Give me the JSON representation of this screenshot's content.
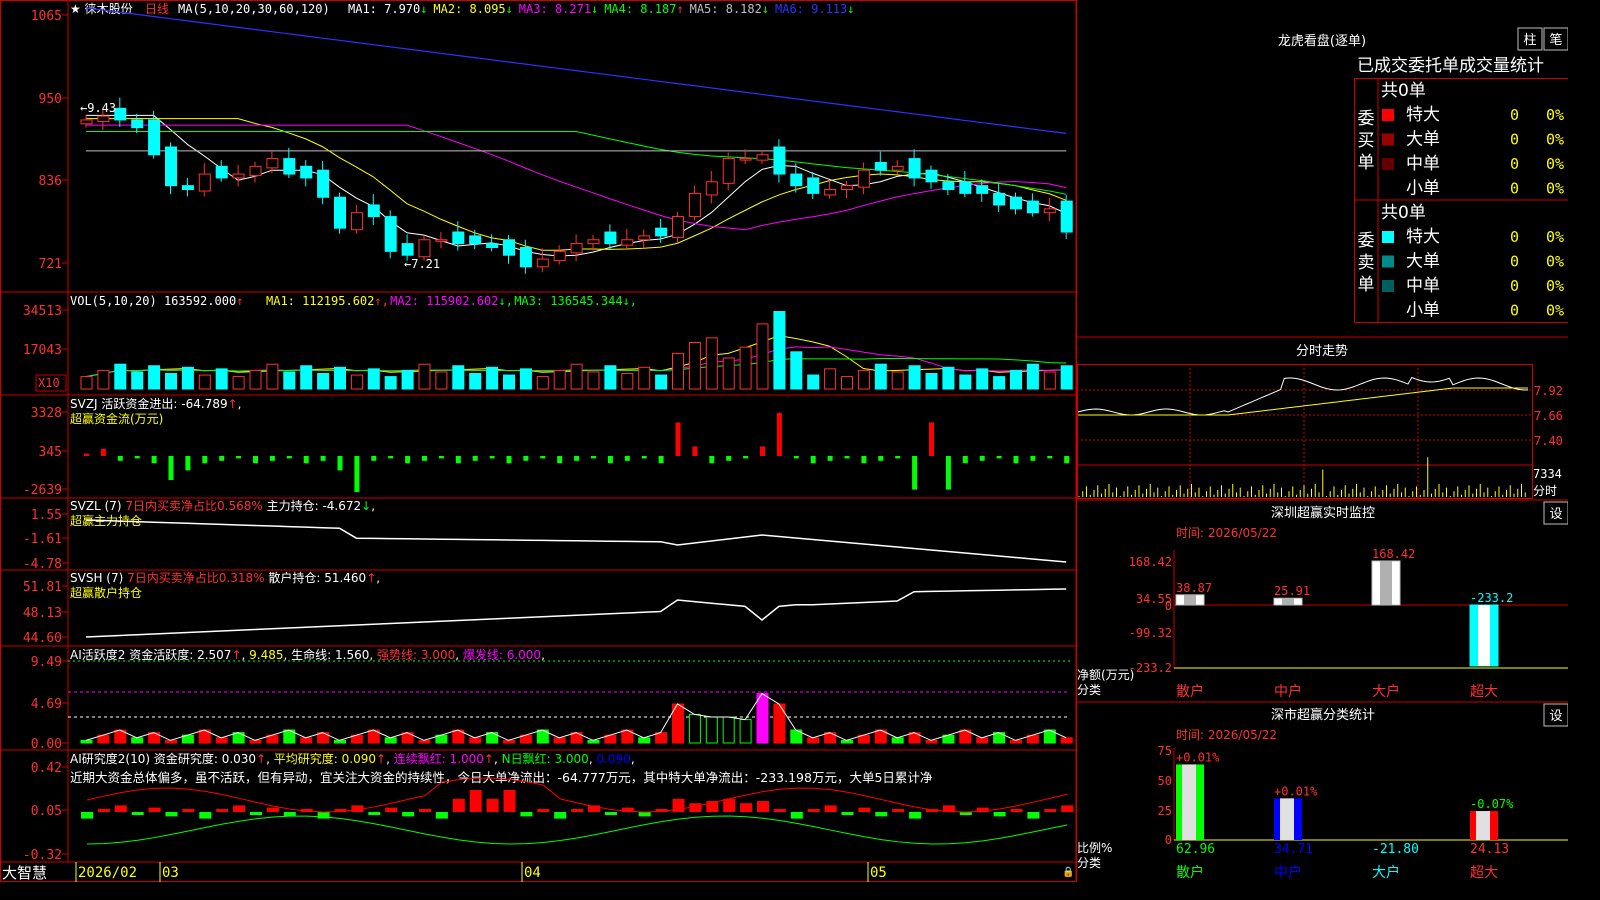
{
  "stock": {
    "name": "徕木股份",
    "period": "日线"
  },
  "main_panel": {
    "legend_ma_prefix": "MA(5,10,20,30,60,120)",
    "ma": [
      {
        "label": "MA1: 7.970",
        "arrow": "↓",
        "color": "#ffffff"
      },
      {
        "label": "MA2: 8.095",
        "arrow": "↓",
        "color": "#ffff00"
      },
      {
        "label": "MA3: 8.271",
        "arrow": "↓",
        "color": "#ff00ff"
      },
      {
        "label": "MA4: 8.187",
        "arrow": "↑",
        "color": "#00ff00"
      },
      {
        "label": "MA5: 8.182",
        "arrow": "↓",
        "color": "#c0c0c0"
      },
      {
        "label": "MA6: 9.113",
        "arrow": "↓",
        "color": "#3030ff"
      }
    ],
    "y_ticks": [
      "1065",
      "950",
      "836",
      "721"
    ],
    "high_label": "←9.43",
    "low_label": "←7.21",
    "y_range": [
      6.9,
      10.7
    ]
  },
  "vol_panel": {
    "title": "VOL(5,10,20)",
    "value": "163592.000",
    "value_arrow": "↑",
    "ma": [
      {
        "label": "MA1: 112195.602",
        "arrow": "↑",
        "color": "#ffff00"
      },
      {
        "label": "MA2: 115902.602",
        "arrow": "↓",
        "color": "#ff00ff"
      },
      {
        "label": "MA3: 136545.344",
        "arrow": "↓",
        "color": "#00ff00"
      }
    ],
    "y_ticks": [
      "34513",
      "17043"
    ],
    "unit": "X10"
  },
  "svzj_panel": {
    "title": "SVZJ",
    "label": "活跃资金进出: -64.789",
    "arrow": "↑",
    "subtitle": "超赢资金流(万元)",
    "y_ticks": [
      "3328",
      "345",
      "-2639"
    ]
  },
  "svzl_panel": {
    "title": "SVZL (7)",
    "label": "7日内买卖净占比0.568%",
    "label2": "主力持仓: -4.672",
    "arrow": "↓",
    "subtitle": "超赢主力持仓",
    "y_ticks": [
      "1.55",
      "-1.61",
      "-4.78"
    ]
  },
  "svsh_panel": {
    "title": "SVSH (7)",
    "label": "7日内买卖净占比0.318%",
    "label2": "散户持仓: 51.460",
    "arrow": "↑",
    "subtitle": "超赢散户持仓",
    "y_ticks": [
      "51.81",
      "48.13",
      "44.60"
    ]
  },
  "ai_active_panel": {
    "title": "AI活跃度2",
    "label": "资金活跃度: 2.507",
    "arrow": "↑",
    "value2": "9.485",
    "life_line": "生命线: 1.560",
    "strong_line": "强势线: 3.000",
    "burst_line": "爆发线: 6.000",
    "y_ticks": [
      "9.49",
      "4.69",
      "0.00"
    ]
  },
  "ai_research_panel": {
    "title": "AI研究度2(10)",
    "label": "资金研究度: 0.030",
    "avg": "平均研究度: 0.090",
    "cont": "连续飘红: 1.000",
    "nday": "N日飘红: 3.000",
    "nday2": "0.090",
    "comment": "近期大资金总体偏多，虽不活跃，但有异动，宜关注大资金的持续性，今日大单净流出：-64.777万元，其中特大单净流出：-233.198万元，大单5日累计净",
    "y_ticks": [
      "0.42",
      "0.05",
      "-0.32"
    ]
  },
  "footer": {
    "brand": "大智慧",
    "date_labels": [
      "2026/02",
      "03",
      "04",
      "05"
    ]
  },
  "right": {
    "longhu": {
      "title": "龙虎看盘(逐单)",
      "btn1": "柱",
      "btn2": "笔",
      "tabs": "已成交委托单成交量统计",
      "buy": {
        "side": "委买单",
        "total": "共0单",
        "rows": [
          {
            "label": "特大",
            "val": "0",
            "pct": "0%",
            "color": "#ff0000"
          },
          {
            "label": "大单",
            "val": "0",
            "pct": "0%",
            "color": "#990000"
          },
          {
            "label": "中单",
            "val": "0",
            "pct": "0%",
            "color": "#660000"
          },
          {
            "label": "小单",
            "val": "0",
            "pct": "0%",
            "color": "#000000"
          }
        ]
      },
      "sell": {
        "side": "委卖单",
        "total": "共0单",
        "rows": [
          {
            "label": "特大",
            "val": "0",
            "pct": "0%",
            "color": "#00ffff"
          },
          {
            "label": "大单",
            "val": "0",
            "pct": "0%",
            "color": "#008b8b"
          },
          {
            "label": "中单",
            "val": "0",
            "pct": "0%",
            "color": "#006060"
          },
          {
            "label": "小单",
            "val": "0",
            "pct": "0%",
            "color": "#000000"
          }
        ]
      }
    },
    "intraday": {
      "title": "分时走势",
      "y_ticks": [
        "7.92",
        "7.66",
        "7.40"
      ],
      "vol_tick": "7334",
      "unit": "分时"
    },
    "sz_monitor": {
      "title": "深圳超赢实时监控",
      "btn": "设",
      "time": "时间: 2026/05/22",
      "y_ticks": [
        "168.42",
        "34.55",
        "0",
        "-99.32",
        "-233.2"
      ],
      "unit": "净额(万元)",
      "unit2": "分类",
      "bars": [
        {
          "cat": "散户",
          "value": 38.87,
          "label": "38.87"
        },
        {
          "cat": "中户",
          "value": 25.91,
          "label": "25.91"
        },
        {
          "cat": "大户",
          "value": 168.42,
          "label": "168.42"
        },
        {
          "cat": "超大",
          "value": -233.2,
          "label": "-233.2"
        }
      ]
    },
    "sz_class": {
      "title": "深市超赢分类统计",
      "btn": "设",
      "time": "时间: 2026/05/22",
      "y_ticks": [
        "75",
        "50",
        "25",
        "0"
      ],
      "unit": "比例%",
      "unit2": "分类",
      "bars": [
        {
          "cat": "散户",
          "value": 62.96,
          "top": "+0.01%",
          "bottom": "62.96",
          "color": "#00ff00"
        },
        {
          "cat": "中户",
          "value": 34.71,
          "top": "+0.01%",
          "bottom": "34.71",
          "color": "#0000ff"
        },
        {
          "cat": "大户",
          "value": 0,
          "top": "",
          "bottom": "-21.80",
          "color": "#00ffff"
        },
        {
          "cat": "超大",
          "value": 24.13,
          "top": "-0.07%",
          "bottom": "24.13",
          "color": "#ff0000"
        }
      ]
    }
  },
  "chart_data": {
    "type": "candlestick",
    "ylim": [
      7.0,
      10.7
    ],
    "series": [
      {
        "name": "close",
        "values": [
          9.2,
          9.25,
          9.2,
          9.1,
          8.75,
          8.35,
          8.3,
          8.5,
          8.45,
          8.5,
          8.6,
          8.7,
          8.5,
          8.45,
          8.2,
          7.8,
          8.0,
          7.95,
          7.5,
          7.45,
          7.65,
          7.65,
          7.6,
          7.6,
          7.55,
          7.45,
          7.3,
          7.4,
          7.5,
          7.6,
          7.65,
          7.6,
          7.65,
          7.7,
          7.7,
          7.95,
          8.25,
          8.4,
          8.7,
          8.7,
          8.75,
          8.5,
          8.35,
          8.25,
          8.3,
          8.35,
          8.55,
          8.55,
          8.6,
          8.45,
          8.4,
          8.3,
          8.25,
          8.25,
          8.1,
          8.05,
          8.0,
          8.05,
          8.0,
          7.75,
          8.0,
          8.1
        ]
      }
    ]
  }
}
